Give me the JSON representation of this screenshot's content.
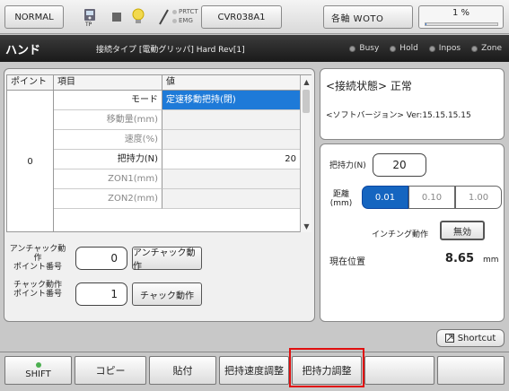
{
  "topbar": {
    "mode_label": "NORMAL",
    "tp_label": "TP",
    "prtct_label": "PRTCT",
    "emg_label": "EMG",
    "program_label": "CVR038A1",
    "axis_label": "各軸 WOTO",
    "speed_text": "1 %",
    "speed_value": 1
  },
  "titlebar": {
    "title": "ハンド",
    "connection_info": "接続タイプ [電動グリッパ]  Hard Rev[1]",
    "indicators": [
      "Busy",
      "Hold",
      "Inpos",
      "Zone"
    ]
  },
  "table": {
    "headers": [
      "ポイント",
      "項目",
      "値"
    ],
    "point": "0",
    "rows": [
      {
        "item": "モード",
        "value": "定速移動把持(閉)",
        "selected": true
      },
      {
        "item": "移動量(mm)",
        "value": "",
        "dim": true
      },
      {
        "item": "速度(%)",
        "value": "",
        "dim": true
      },
      {
        "item": "把持力(N)",
        "value": "20",
        "dim": false
      },
      {
        "item": "ZON1(mm)",
        "value": "",
        "dim": true
      },
      {
        "item": "ZON2(mm)",
        "value": "",
        "dim": true
      }
    ]
  },
  "unchuck": {
    "label": "アンチャック動作\nポイント番号",
    "value": "0",
    "button": "アンチャック動作"
  },
  "chuck": {
    "label": "チャック動作\nポイント番号",
    "value": "1",
    "button": "チャック動作"
  },
  "status": {
    "connection": "<接続状態> 正常",
    "version": "<ソフトバージョン> Ver:15.15.15.15"
  },
  "control": {
    "grip_force_label": "把持力(N)",
    "grip_force_value": "20",
    "distance_label": "距離\n(mm)",
    "distance_options": [
      "0.01",
      "0.10",
      "1.00"
    ],
    "inching_label": "インチング動作",
    "inching_value": "無効",
    "position_label": "現在位置",
    "position_value": "8.65",
    "position_unit": "mm"
  },
  "shortcut_label": "Shortcut",
  "footer": {
    "buttons": [
      "SHIFT",
      "コピー",
      "貼付",
      "把持速度調整",
      "把持力調整",
      "",
      ""
    ]
  }
}
